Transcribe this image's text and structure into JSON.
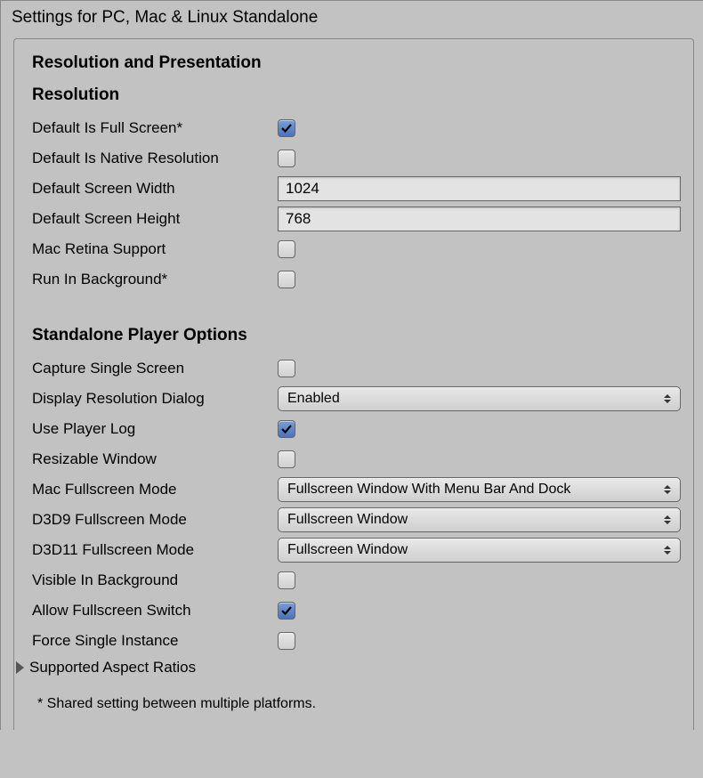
{
  "panelTitle": "Settings for PC, Mac & Linux Standalone",
  "sectionTitle": "Resolution and Presentation",
  "resolution": {
    "heading": "Resolution",
    "defaultFullScreen": {
      "label": "Default Is Full Screen*",
      "checked": true
    },
    "defaultNativeRes": {
      "label": "Default Is Native Resolution",
      "checked": false
    },
    "defaultWidth": {
      "label": "Default Screen Width",
      "value": "1024"
    },
    "defaultHeight": {
      "label": "Default Screen Height",
      "value": "768"
    },
    "macRetina": {
      "label": "Mac Retina Support",
      "checked": false
    },
    "runInBackground": {
      "label": "Run In Background*",
      "checked": false
    }
  },
  "standalone": {
    "heading": "Standalone Player Options",
    "captureSingle": {
      "label": "Capture Single Screen",
      "checked": false
    },
    "displayDialog": {
      "label": "Display Resolution Dialog",
      "value": "Enabled"
    },
    "usePlayerLog": {
      "label": "Use Player Log",
      "checked": true
    },
    "resizableWindow": {
      "label": "Resizable Window",
      "checked": false
    },
    "macFullscreen": {
      "label": "Mac Fullscreen Mode",
      "value": "Fullscreen Window With Menu Bar And Dock"
    },
    "d3d9Fullscreen": {
      "label": "D3D9 Fullscreen Mode",
      "value": "Fullscreen Window"
    },
    "d3d11Fullscreen": {
      "label": "D3D11 Fullscreen Mode",
      "value": "Fullscreen Window"
    },
    "visibleInBackground": {
      "label": "Visible In Background",
      "checked": false
    },
    "allowFullscreenSwitch": {
      "label": "Allow Fullscreen Switch",
      "checked": true
    },
    "forceSingleInstance": {
      "label": "Force Single Instance",
      "checked": false
    },
    "supportedAspectRatios": {
      "label": "Supported Aspect Ratios"
    }
  },
  "footnote": "* Shared setting between multiple platforms."
}
